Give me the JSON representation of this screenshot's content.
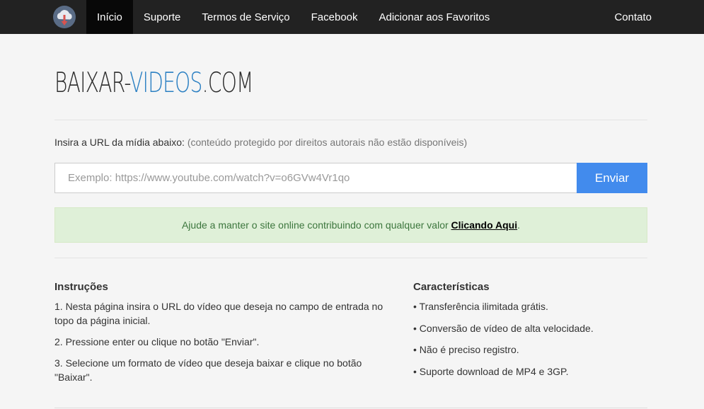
{
  "nav": {
    "logo_icon": "cloud-download-icon",
    "items": [
      {
        "label": "Início",
        "active": true
      },
      {
        "label": "Suporte"
      },
      {
        "label": "Termos de Serviço"
      },
      {
        "label": "Facebook"
      },
      {
        "label": "Adicionar aos Favoritos"
      }
    ],
    "right_label": "Contato"
  },
  "logo": {
    "part1": "BAIXAR-",
    "part2": "VIDEOS",
    "part3": ".COM"
  },
  "form": {
    "label": "Insira a URL da mídia abaixo:",
    "note": "(conteúdo protegido por direitos autorais não estão disponíveis)",
    "placeholder": "Exemplo: https://www.youtube.com/watch?v=o6GVw4Vr1qo",
    "submit_label": "Enviar"
  },
  "alert": {
    "text": "Ajude a manter o site online contribuindo com qualquer valor",
    "link": "Clicando Aqui",
    "suffix": "."
  },
  "instructions": {
    "title": "Instruções",
    "steps": [
      "1. Nesta página insira o URL do vídeo que deseja no campo de entrada no topo da página inicial.",
      "2. Pressione enter ou clique no botão \"Enviar\".",
      "3. Selecione um formato de vídeo que deseja baixar e clique no botão \"Baixar\"."
    ]
  },
  "features": {
    "title": "Características",
    "items": [
      "• Transferência ilimitada grátis.",
      "• Conversão de vídeo de alta velocidade.",
      "• Não é preciso registro.",
      "• Suporte download de MP4 e 3GP."
    ]
  },
  "colors": {
    "navbar": "#222222",
    "accent": "#428bed",
    "logo_blue": "#2a7fc2",
    "alert_bg": "#dff0d8"
  }
}
